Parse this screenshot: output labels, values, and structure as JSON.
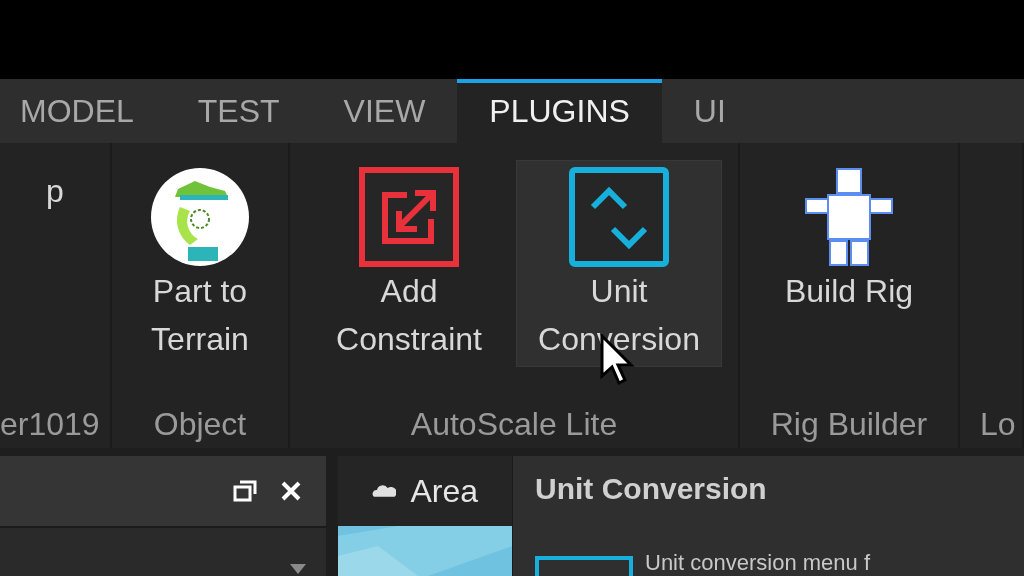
{
  "tabs": [
    {
      "label": "MODEL",
      "selected": false
    },
    {
      "label": "TEST",
      "selected": false
    },
    {
      "label": "VIEW",
      "selected": false
    },
    {
      "label": "PLUGINS",
      "selected": true
    },
    {
      "label": "UI",
      "selected": false
    }
  ],
  "ribbon": {
    "groups": [
      {
        "label": "er1019",
        "buttons": [
          {
            "label": "p",
            "kind": "text",
            "hovered": false
          }
        ]
      },
      {
        "label": "Object",
        "buttons": [
          {
            "label": "Part to Terrain",
            "kind": "terrain",
            "hovered": false
          }
        ]
      },
      {
        "label": "AutoScale Lite",
        "buttons": [
          {
            "label": "Add Constraint",
            "kind": "constraint",
            "hovered": false
          },
          {
            "label": "Unit Conversion",
            "kind": "conversion",
            "hovered": true
          }
        ]
      },
      {
        "label": "Rig Builder",
        "buttons": [
          {
            "label": "Build Rig",
            "kind": "rig",
            "hovered": false
          }
        ]
      },
      {
        "label": "Lo"
      }
    ]
  },
  "viewport_tab": {
    "label": "Area"
  },
  "tooltip": {
    "title": "Unit Conversion",
    "description": "Unit conversion menu f"
  }
}
